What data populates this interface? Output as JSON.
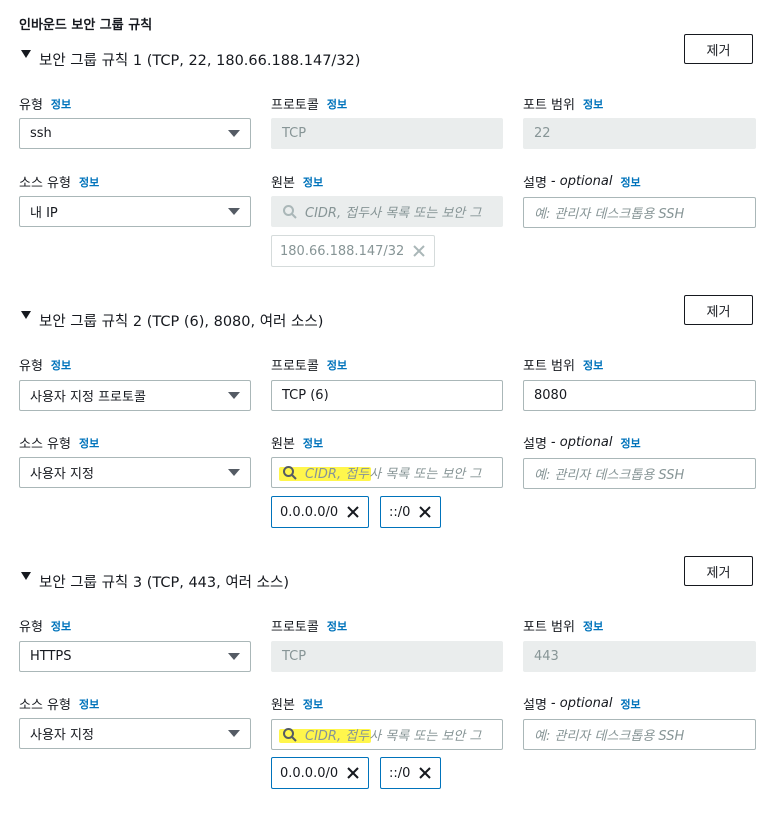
{
  "page": {
    "title": "인바운드 보안 그룹 규칙"
  },
  "labels": {
    "type": "유형",
    "protocol": "프로토콜",
    "port_range": "포트 범위",
    "source_type": "소스 유형",
    "source": "원본",
    "description": "설명",
    "optional": "- optional",
    "info": "정보",
    "remove": "제거"
  },
  "source_placeholder": "CIDR, 접두사 목록 또는 보안 그",
  "description_placeholder": "예: 관리자 데스크톱용 SSH",
  "rules": [
    {
      "title": "보안 그룹 규칙 1 (TCP, 22, 180.66.188.147/32)",
      "type": "ssh",
      "protocol": "TCP",
      "port": "22",
      "source_type": "내 IP",
      "tokens": [
        "180.66.188.147/32"
      ]
    },
    {
      "title": "보안 그룹 규칙 2 (TCP (6), 8080, 여러 소스)",
      "type": "사용자 지정 프로토콜",
      "protocol": "TCP (6)",
      "port": "8080",
      "source_type": "사용자 지정",
      "tokens": [
        "0.0.0.0/0",
        "::/0"
      ]
    },
    {
      "title": "보안 그룹 규칙 3 (TCP, 443, 여러 소스)",
      "type": "HTTPS",
      "protocol": "TCP",
      "port": "443",
      "source_type": "사용자 지정",
      "tokens": [
        "0.0.0.0/0",
        "::/0"
      ]
    }
  ],
  "colors": {
    "info_link": "#0073bb",
    "token_active_border": "#0073bb",
    "highlight": "#fff200"
  }
}
